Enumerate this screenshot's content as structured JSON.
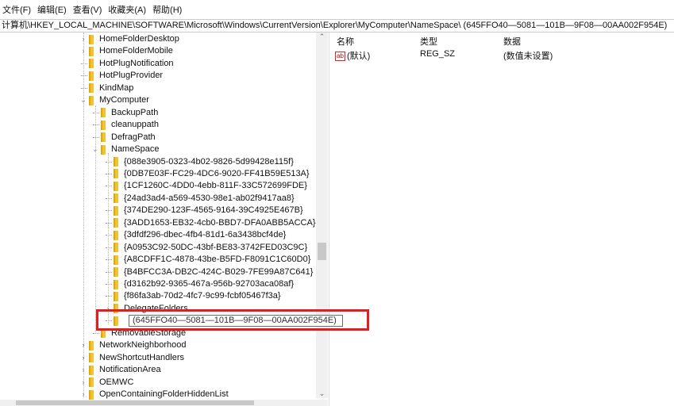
{
  "menu": [
    "文件(F)",
    "编辑(E)",
    "查看(V)",
    "收藏夹(A)",
    "帮助(H)"
  ],
  "address": "计算机\\HKEY_LOCAL_MACHINE\\SOFTWARE\\Microsoft\\Windows\\CurrentVersion\\Explorer\\MyComputer\\NameSpace\\  (645FFO40—5081—101B—9F08—00AA002F954E)",
  "tree": [
    {
      "label": "HomeFolderDesktop",
      "level": 0,
      "state": "collapsed"
    },
    {
      "label": "HomeFolderMobile",
      "level": 0,
      "state": "collapsed"
    },
    {
      "label": "HotPlugNotification",
      "level": 0,
      "state": "leaf"
    },
    {
      "label": "HotPlugProvider",
      "level": 0,
      "state": "leaf"
    },
    {
      "label": "KindMap",
      "level": 0,
      "state": "leaf"
    },
    {
      "label": "MyComputer",
      "level": 0,
      "state": "expanded"
    },
    {
      "label": "BackupPath",
      "level": 1,
      "state": "leaf"
    },
    {
      "label": "cleanuppath",
      "level": 1,
      "state": "leaf"
    },
    {
      "label": "DefragPath",
      "level": 1,
      "state": "leaf"
    },
    {
      "label": "NameSpace",
      "level": 1,
      "state": "expanded"
    },
    {
      "label": "{088e3905-0323-4b02-9826-5d99428e115f}",
      "level": 2,
      "state": "leaf"
    },
    {
      "label": "{0DB7E03F-FC29-4DC6-9020-FF41B59E513A}",
      "level": 2,
      "state": "leaf"
    },
    {
      "label": "{1CF1260C-4DD0-4ebb-811F-33C572699FDE}",
      "level": 2,
      "state": "leaf"
    },
    {
      "label": "{24ad3ad4-a569-4530-98e1-ab02f9417aa8}",
      "level": 2,
      "state": "leaf"
    },
    {
      "label": "{374DE290-123F-4565-9164-39C4925E467B}",
      "level": 2,
      "state": "leaf"
    },
    {
      "label": "{3ADD1653-EB32-4cb0-BBD7-DFA0ABB5ACCA}",
      "level": 2,
      "state": "leaf"
    },
    {
      "label": "{3dfdf296-dbec-4fb4-81d1-6a3438bcf4de}",
      "level": 2,
      "state": "leaf"
    },
    {
      "label": "{A0953C92-50DC-43bf-BE83-3742FED03C9C}",
      "level": 2,
      "state": "leaf"
    },
    {
      "label": "{A8CDFF1C-4878-43be-B5FD-F8091C1C60D0}",
      "level": 2,
      "state": "leaf"
    },
    {
      "label": "{B4BFCC3A-DB2C-424C-B029-7FE99A87C641}",
      "level": 2,
      "state": "leaf"
    },
    {
      "label": "{d3162b92-9365-467a-956b-92703aca08af}",
      "level": 2,
      "state": "leaf"
    },
    {
      "label": "{f86fa3ab-70d2-4fc7-9c99-fcbf05467f3a}",
      "level": 2,
      "state": "leaf"
    },
    {
      "label": "DelegateFolders",
      "level": 2,
      "state": "collapsed"
    },
    {
      "label": "",
      "level": 2,
      "state": "editing"
    },
    {
      "label": "RemovableStorage",
      "level": 1,
      "state": "leaf"
    },
    {
      "label": "NetworkNeighborhood",
      "level": 0,
      "state": "collapsed"
    },
    {
      "label": "NewShortcutHandlers",
      "level": 0,
      "state": "collapsed"
    },
    {
      "label": "NotificationArea",
      "level": 0,
      "state": "collapsed"
    },
    {
      "label": "OEMWC",
      "level": 0,
      "state": "collapsed"
    },
    {
      "label": "OpenContainingFolderHiddenList",
      "level": 0,
      "state": "collapsed"
    }
  ],
  "new_key_name": "(645FFO40—5081—101B—9F08—00AA002F954E)",
  "highlight_color": "#e02020",
  "columns": {
    "name": "名称",
    "type": "类型",
    "data": "数据"
  },
  "values": [
    {
      "name": "(默认)",
      "type": "REG_SZ",
      "data": "(数值未设置)",
      "icon": "string-value-icon"
    }
  ]
}
